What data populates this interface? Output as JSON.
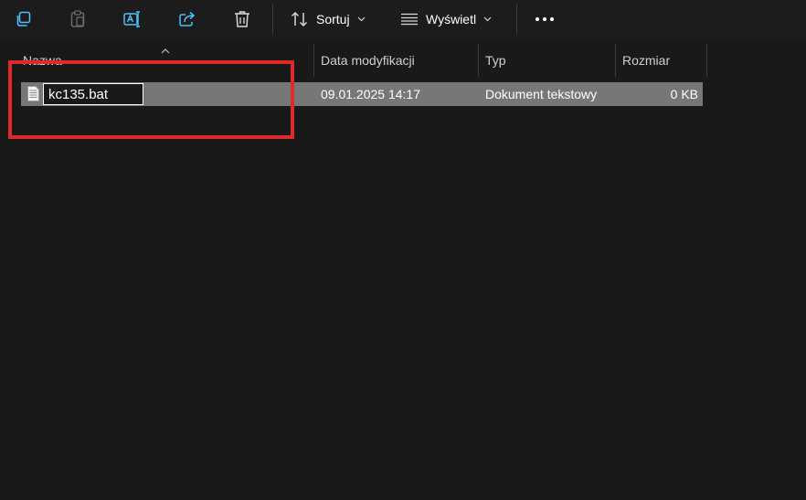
{
  "toolbar": {
    "sort_label": "Sortuj",
    "view_label": "Wyświetl",
    "icons": [
      "copy-icon",
      "paste-icon",
      "rename-icon",
      "share-icon",
      "delete-icon",
      "sort-icon",
      "view-icon",
      "more-icon"
    ]
  },
  "columns": {
    "name": "Nazwa",
    "date": "Data modyfikacji",
    "type": "Typ",
    "size": "Rozmiar"
  },
  "files": [
    {
      "name": "kc135.bat",
      "date": "09.01.2025 14:17",
      "type": "Dokument tekstowy",
      "size": "0 KB"
    }
  ],
  "colors": {
    "background": "#191919",
    "selected_row": "#777777",
    "accent": "#4cc2ff",
    "annotation": "#e02a2a"
  }
}
